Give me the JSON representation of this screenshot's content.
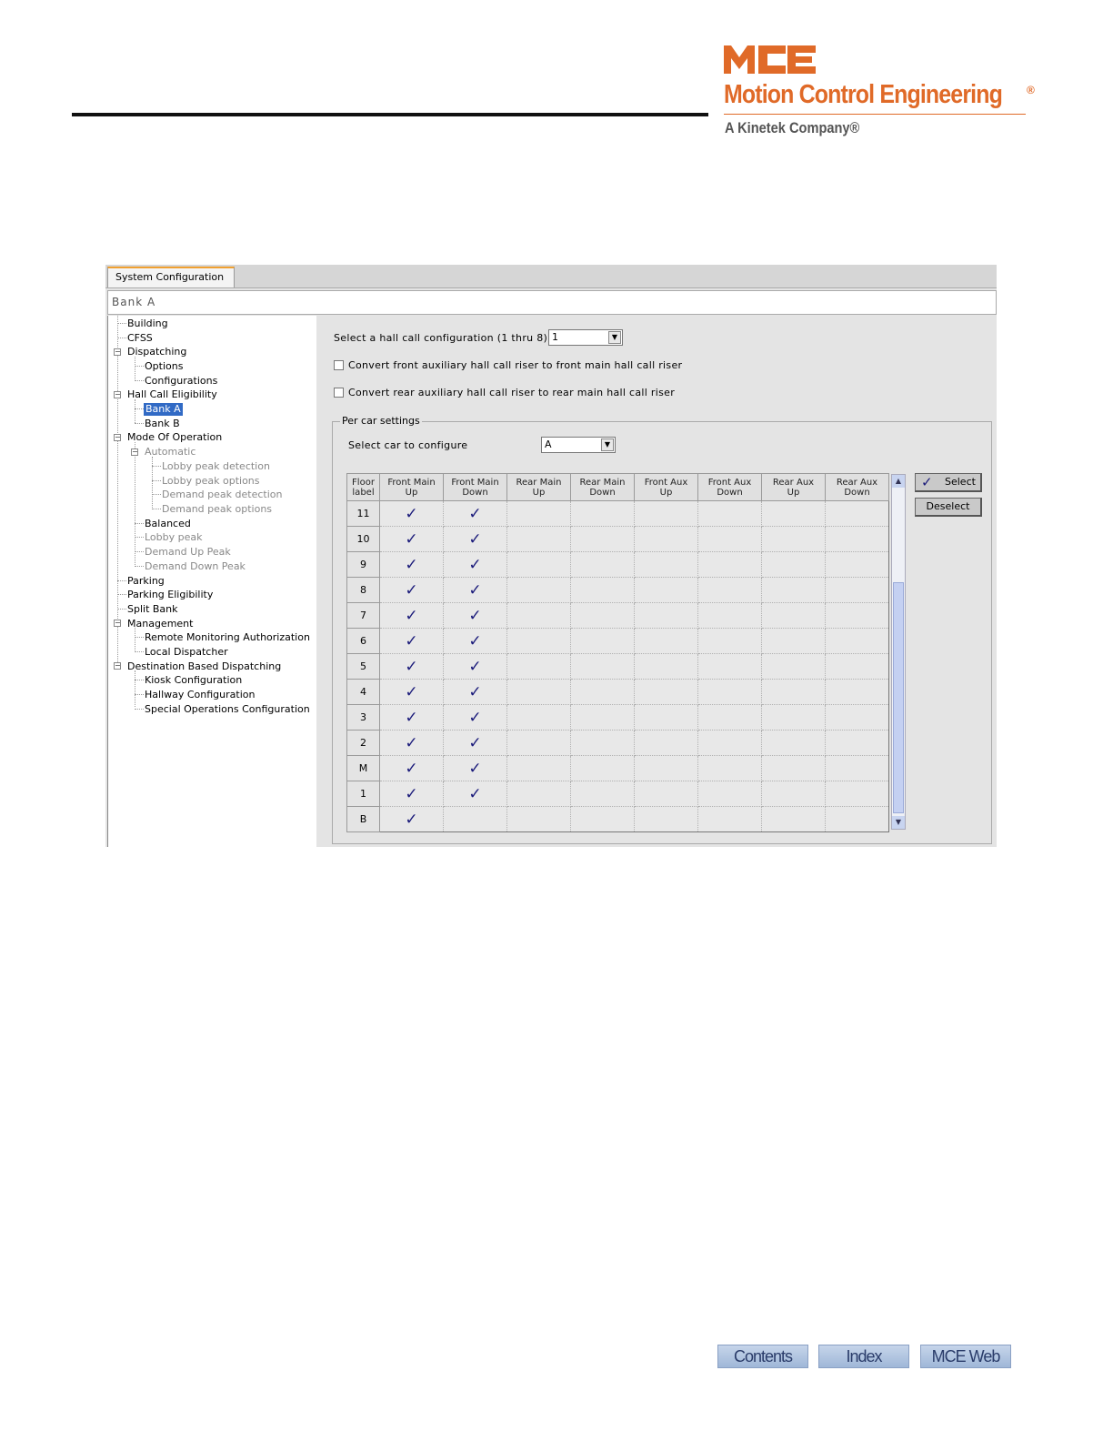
{
  "brand": {
    "name": "Motion Control Engineering",
    "registered": "®",
    "subtitle": "A Kinetek Company®",
    "color": "#e06a28"
  },
  "app": {
    "tab": "System Configuration",
    "title": "Bank A"
  },
  "tree": {
    "building": "Building",
    "cfss": "CFSS",
    "dispatching": "Dispatching",
    "options": "Options",
    "configurations": "Configurations",
    "hall_call_eligibility": "Hall Call Eligibility",
    "bank_a": "Bank A",
    "bank_b": "Bank B",
    "mode_of_operation": "Mode Of Operation",
    "automatic": "Automatic",
    "lobby_peak_detection": "Lobby peak detection",
    "lobby_peak_options": "Lobby peak options",
    "demand_peak_detection": "Demand peak detection",
    "demand_peak_options": "Demand peak options",
    "balanced": "Balanced",
    "lobby_peak": "Lobby peak",
    "demand_up_peak": "Demand Up Peak",
    "demand_down_peak": "Demand Down Peak",
    "parking": "Parking",
    "parking_eligibility": "Parking Eligibility",
    "split_bank": "Split Bank",
    "management": "Management",
    "remote_monitoring": "Remote Monitoring Authorization",
    "local_dispatcher": "Local Dispatcher",
    "dbd": "Destination Based Dispatching",
    "kiosk": "Kiosk Configuration",
    "hallway": "Hallway Configuration",
    "special_ops": "Special Operations Configuration"
  },
  "form": {
    "hall_call_label": "Select a hall call configuration (1 thru 8)",
    "hall_call_value": "1",
    "convert_front_label": "Convert front auxiliary hall call riser to front main hall call riser",
    "convert_rear_label": "Convert rear auxiliary hall call riser to rear main hall call riser",
    "per_car_legend": "Per car settings",
    "select_car_label": "Select car to configure",
    "select_car_value": "A",
    "select_button": "Select",
    "deselect_button": "Deselect"
  },
  "grid": {
    "headers": [
      [
        "Floor",
        "label"
      ],
      [
        "Front Main",
        "Up"
      ],
      [
        "Front Main",
        "Down"
      ],
      [
        "Rear Main",
        "Up"
      ],
      [
        "Rear Main",
        "Down"
      ],
      [
        "Front Aux",
        "Up"
      ],
      [
        "Front Aux",
        "Down"
      ],
      [
        "Rear Aux",
        "Up"
      ],
      [
        "Rear Aux",
        "Down"
      ]
    ],
    "check_glyph": "✓",
    "rows": [
      {
        "floor": "11",
        "checks": [
          true,
          true,
          false,
          false,
          false,
          false,
          false,
          false
        ]
      },
      {
        "floor": "10",
        "checks": [
          true,
          true,
          false,
          false,
          false,
          false,
          false,
          false
        ]
      },
      {
        "floor": "9",
        "checks": [
          true,
          true,
          false,
          false,
          false,
          false,
          false,
          false
        ]
      },
      {
        "floor": "8",
        "checks": [
          true,
          true,
          false,
          false,
          false,
          false,
          false,
          false
        ]
      },
      {
        "floor": "7",
        "checks": [
          true,
          true,
          false,
          false,
          false,
          false,
          false,
          false
        ]
      },
      {
        "floor": "6",
        "checks": [
          true,
          true,
          false,
          false,
          false,
          false,
          false,
          false
        ]
      },
      {
        "floor": "5",
        "checks": [
          true,
          true,
          false,
          false,
          false,
          false,
          false,
          false
        ]
      },
      {
        "floor": "4",
        "checks": [
          true,
          true,
          false,
          false,
          false,
          false,
          false,
          false
        ]
      },
      {
        "floor": "3",
        "checks": [
          true,
          true,
          false,
          false,
          false,
          false,
          false,
          false
        ]
      },
      {
        "floor": "2",
        "checks": [
          true,
          true,
          false,
          false,
          false,
          false,
          false,
          false
        ]
      },
      {
        "floor": "M",
        "checks": [
          true,
          true,
          false,
          false,
          false,
          false,
          false,
          false
        ]
      },
      {
        "floor": "1",
        "checks": [
          true,
          true,
          false,
          false,
          false,
          false,
          false,
          false
        ]
      },
      {
        "floor": "B",
        "checks": [
          true,
          false,
          false,
          false,
          false,
          false,
          false,
          false
        ]
      }
    ]
  },
  "footer": {
    "contents": "Contents",
    "index": "Index",
    "mce_web": "MCE Web"
  }
}
